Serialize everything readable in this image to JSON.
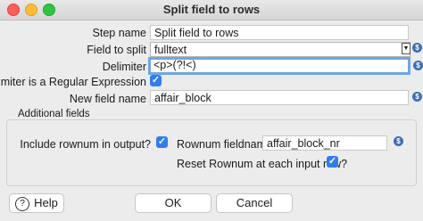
{
  "window": {
    "title": "Split field to rows"
  },
  "form": {
    "step_name": {
      "label": "Step name",
      "value": "Split field to rows"
    },
    "field_to_split": {
      "label": "Field to split",
      "value": "fulltext"
    },
    "delimiter": {
      "label": "Delimiter",
      "value": "<p>(?!<)"
    },
    "delimiter_regex": {
      "label": "Delimiter is a Regular Expression",
      "checked": true
    },
    "new_field_name": {
      "label": "New field name",
      "value": "affair_block"
    }
  },
  "additional": {
    "title": "Additional fields",
    "include_rownum": {
      "label": "Include rownum in output?",
      "checked": true
    },
    "rownum_fieldname": {
      "label": "Rownum fieldname",
      "value": "affair_block_nr"
    },
    "reset_rownum": {
      "label": "Reset Rownum at each input row?",
      "checked": true
    }
  },
  "buttons": {
    "help": "Help",
    "ok": "OK",
    "cancel": "Cancel"
  },
  "icons": {
    "variable": "dollar-variable-icon",
    "checkbox_mark": "✓",
    "dropdown_arrow": "▼",
    "help": "?"
  },
  "colors": {
    "accent": "#2f7df6",
    "focus_ring": "#6fa6e6",
    "variable_icon": "#3b6fb6"
  }
}
